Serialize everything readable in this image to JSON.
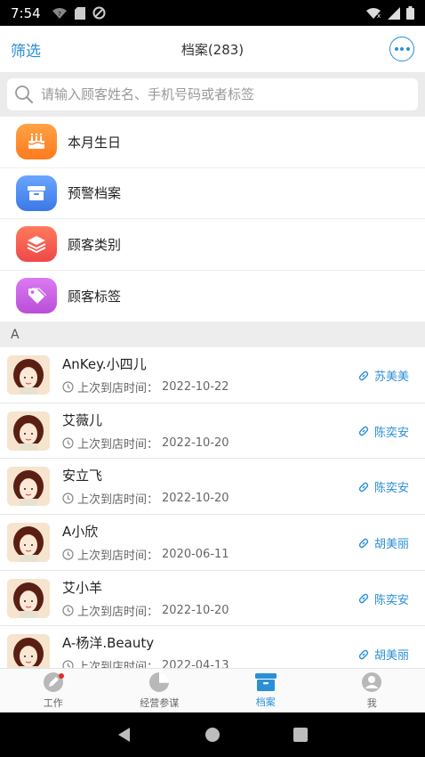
{
  "status_bar": {
    "time": "7:54"
  },
  "header": {
    "filter_label": "筛选",
    "title": "档案(283)"
  },
  "search": {
    "placeholder": "请输入顾客姓名、手机号码或者标签"
  },
  "quick_menu": [
    {
      "label": "本月生日",
      "icon": "birthday-cake-icon",
      "color": "#ff8a2b"
    },
    {
      "label": "预警档案",
      "icon": "archive-box-icon",
      "color": "#4a8cf0"
    },
    {
      "label": "顾客类别",
      "icon": "layers-icon",
      "color": "#f05a4e"
    },
    {
      "label": "顾客标签",
      "icon": "tag-icon",
      "color": "#c25be0"
    }
  ],
  "section_letter": "A",
  "customers": [
    {
      "name": "AnKey.小四儿",
      "time_label": "上次到店时间：",
      "date": "2022-10-22",
      "staff": "苏美美"
    },
    {
      "name": "艾薇儿",
      "time_label": "上次到店时间：",
      "date": "2022-10-20",
      "staff": "陈奕安"
    },
    {
      "name": "安立飞",
      "time_label": "上次到店时间：",
      "date": "2022-10-20",
      "staff": "陈奕安"
    },
    {
      "name": "A小欣",
      "time_label": "上次到店时间：",
      "date": "2020-06-11",
      "staff": "胡美丽"
    },
    {
      "name": "艾小羊",
      "time_label": "上次到店时间：",
      "date": "2022-10-20",
      "staff": "陈奕安"
    },
    {
      "name": "A-杨洋.Beauty",
      "time_label": "上次到店时间：",
      "date": "2022-04-13",
      "staff": "胡美丽"
    }
  ],
  "tabs": [
    {
      "label": "工作",
      "icon": "pen-icon",
      "active": false
    },
    {
      "label": "经营参谋",
      "icon": "pie-chart-icon",
      "active": false
    },
    {
      "label": "档案",
      "icon": "archive-box-icon",
      "active": true
    },
    {
      "label": "我",
      "icon": "user-icon",
      "active": false
    }
  ],
  "colors": {
    "accent": "#2a8fd6",
    "badge": "#e52929"
  }
}
